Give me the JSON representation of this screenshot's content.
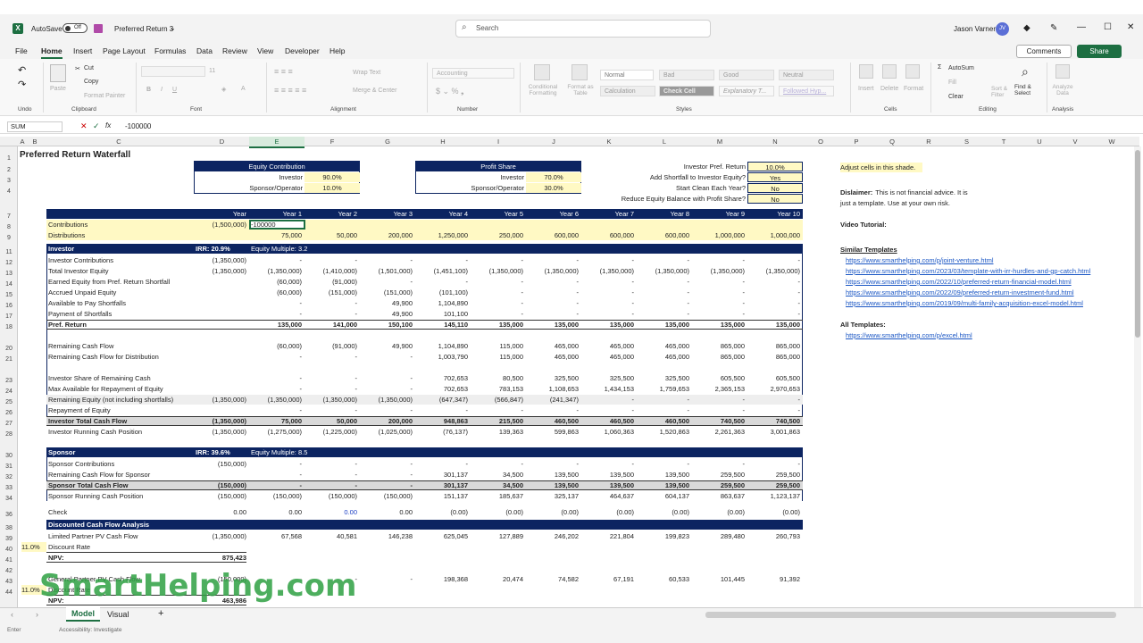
{
  "window": {
    "autosave": "AutoSave",
    "autosave_state": "Off",
    "filename": "Preferred Return 3",
    "search_placeholder": "Search",
    "user": "Jason Varner",
    "user_initials": "JV"
  },
  "menu": {
    "items": [
      "File",
      "Home",
      "Insert",
      "Page Layout",
      "Formulas",
      "Data",
      "Review",
      "View",
      "Developer",
      "Help"
    ],
    "comments": "Comments",
    "share": "Share"
  },
  "ribbon": {
    "undo": "Undo",
    "clipboard": "Clipboard",
    "paste": "Paste",
    "cut": "Cut",
    "copy": "Copy",
    "format_painter": "Format Painter",
    "font": "Font",
    "font_size": "11",
    "alignment": "Alignment",
    "wrap_text": "Wrap Text",
    "merge_center": "Merge & Center",
    "number": "Number",
    "number_format": "Accounting",
    "cond_fmt": "Conditional Formatting",
    "format_table": "Format as Table",
    "styles": "Styles",
    "style_normal": "Normal",
    "style_bad": "Bad",
    "style_good": "Good",
    "style_neutral": "Neutral",
    "style_calc": "Calculation",
    "style_check": "Check Cell",
    "style_expl": "Explanatory T...",
    "style_followed": "Followed Hyp...",
    "cells": "Cells",
    "insert": "Insert",
    "delete": "Delete",
    "format": "Format",
    "editing": "Editing",
    "autosum": "AutoSum",
    "fill": "Fill",
    "clear": "Clear",
    "sort_filter": "Sort & Filter",
    "find_select": "Find & Select",
    "analysis": "Analysis",
    "analyze_data": "Analyze Data"
  },
  "formula": {
    "namebox": "SUM",
    "fx": "fx",
    "value": "-100000"
  },
  "columns": [
    "A",
    "B",
    "C",
    "D",
    "E",
    "F",
    "G",
    "H",
    "I",
    "J",
    "K",
    "L",
    "M",
    "N",
    "O",
    "P",
    "Q",
    "R",
    "S",
    "T",
    "U",
    "V",
    "W"
  ],
  "rows": [
    "1",
    "2",
    "3",
    "4",
    "7",
    "8",
    "9",
    "11",
    "12",
    "13",
    "14",
    "15",
    "16",
    "17",
    "18",
    "20",
    "21",
    "23",
    "24",
    "25",
    "26",
    "27",
    "28",
    "30",
    "31",
    "32",
    "33",
    "34",
    "36",
    "38",
    "39",
    "40",
    "41",
    "42",
    "43",
    "44"
  ],
  "sheet": {
    "title": "Preferred Return Waterfall",
    "equity": {
      "header": "Equity Contribution",
      "investor_label": "Investor",
      "investor_val": "90.0%",
      "sponsor_label": "Sponsor/Operator",
      "sponsor_val": "10.0%"
    },
    "profit": {
      "header": "Profit Share",
      "investor_label": "Investor",
      "investor_val": "70.0%",
      "sponsor_label": "Sponsor/Operator",
      "sponsor_val": "30.0%"
    },
    "inputs": [
      {
        "label": "Investor Pref. Return",
        "val": "10.0%"
      },
      {
        "label": "Add Shortfall to Investor Equity?",
        "val": "Yes"
      },
      {
        "label": "Start Clean Each Year?",
        "val": "No"
      },
      {
        "label": "Reduce Equity Balance with Profit Share?",
        "val": "No"
      }
    ],
    "year_header": [
      "Year",
      "Year 1",
      "Year 2",
      "Year 3",
      "Year 4",
      "Year 5",
      "Year 6",
      "Year 7",
      "Year 8",
      "Year 9",
      "Year 10"
    ],
    "contrib_label": "Contributions",
    "contrib": [
      "(1,500,000)",
      "-100000",
      "",
      "",
      "",
      "",
      "",
      "",
      "",
      "",
      ""
    ],
    "dist_label": "Distributions",
    "dist": [
      "",
      "75,000",
      "50,000",
      "200,000",
      "1,250,000",
      "250,000",
      "600,000",
      "600,000",
      "600,000",
      "1,000,000",
      "1,000,000"
    ],
    "investor_hdr": "Investor",
    "investor_irr": "IRR: 20.9%",
    "investor_mult": "Equity Multiple: 3.2",
    "inv_rows": [
      {
        "label": "Investor Contributions",
        "v": [
          "(1,350,000)",
          "-",
          "-",
          "-",
          "-",
          "-",
          "-",
          "-",
          "-",
          "-",
          "-"
        ]
      },
      {
        "label": "Total Investor Equity",
        "v": [
          "(1,350,000)",
          "(1,350,000)",
          "(1,410,000)",
          "(1,501,000)",
          "(1,451,100)",
          "(1,350,000)",
          "(1,350,000)",
          "(1,350,000)",
          "(1,350,000)",
          "(1,350,000)",
          "(1,350,000)"
        ]
      },
      {
        "label": "Earned Equity from Pref. Return Shortfall",
        "v": [
          "",
          "(60,000)",
          "(91,000)",
          "-",
          "-",
          "-",
          "-",
          "-",
          "-",
          "-",
          "-"
        ]
      },
      {
        "label": "Accrued Unpaid Equity",
        "v": [
          "",
          "(60,000)",
          "(151,000)",
          "(151,000)",
          "(101,100)",
          "-",
          "-",
          "-",
          "-",
          "-",
          "-"
        ]
      },
      {
        "label": "Available to Pay Shortfalls",
        "v": [
          "",
          "-",
          "-",
          "49,900",
          "1,104,890",
          "-",
          "-",
          "-",
          "-",
          "-",
          "-"
        ]
      },
      {
        "label": "Payment of Shortfalls",
        "v": [
          "",
          "-",
          "-",
          "49,900",
          "101,100",
          "-",
          "-",
          "-",
          "-",
          "-",
          "-"
        ]
      },
      {
        "label": "Pref. Return",
        "v": [
          "",
          "135,000",
          "141,000",
          "150,100",
          "145,110",
          "135,000",
          "135,000",
          "135,000",
          "135,000",
          "135,000",
          "135,000"
        ],
        "bold": true
      },
      {
        "label": "Remaining Cash Flow",
        "v": [
          "",
          "(60,000)",
          "(91,000)",
          "49,900",
          "1,104,890",
          "115,000",
          "465,000",
          "465,000",
          "465,000",
          "865,000",
          "865,000"
        ]
      },
      {
        "label": "Remaining Cash Flow for Distribution",
        "v": [
          "",
          "-",
          "-",
          "-",
          "1,003,790",
          "115,000",
          "465,000",
          "465,000",
          "465,000",
          "865,000",
          "865,000"
        ]
      },
      {
        "label": "Investor Share of Remaining Cash",
        "v": [
          "",
          "-",
          "-",
          "-",
          "702,653",
          "80,500",
          "325,500",
          "325,500",
          "325,500",
          "605,500",
          "605,500"
        ]
      },
      {
        "label": "Max Available for Repayment of Equity",
        "v": [
          "",
          "-",
          "-",
          "-",
          "702,653",
          "783,153",
          "1,108,653",
          "1,434,153",
          "1,759,653",
          "2,365,153",
          "2,970,653"
        ]
      },
      {
        "label": "Remaining Equity (not including shortfalls)",
        "v": [
          "(1,350,000)",
          "(1,350,000)",
          "(1,350,000)",
          "(1,350,000)",
          "(647,347)",
          "(566,847)",
          "(241,347)",
          "-",
          "-",
          "-",
          "-"
        ]
      },
      {
        "label": "Repayment of Equity",
        "v": [
          "",
          "-",
          "-",
          "-",
          "-",
          "-",
          "-",
          "-",
          "-",
          "-",
          "-"
        ]
      },
      {
        "label": "Investor Total Cash Flow",
        "v": [
          "(1,350,000)",
          "75,000",
          "50,000",
          "200,000",
          "948,863",
          "215,500",
          "460,500",
          "460,500",
          "460,500",
          "740,500",
          "740,500"
        ],
        "bold": true
      },
      {
        "label": "Investor Running Cash Position",
        "v": [
          "(1,350,000)",
          "(1,275,000)",
          "(1,225,000)",
          "(1,025,000)",
          "(76,137)",
          "139,363",
          "599,863",
          "1,060,363",
          "1,520,863",
          "2,261,363",
          "3,001,863"
        ]
      }
    ],
    "sponsor_hdr": "Sponsor",
    "sponsor_irr": "IRR: 39.6%",
    "sponsor_mult": "Equity Multiple: 8.5",
    "sp_rows": [
      {
        "label": "Sponsor Contributions",
        "v": [
          "(150,000)",
          "-",
          "-",
          "-",
          "-",
          "-",
          "-",
          "-",
          "-",
          "-",
          "-"
        ]
      },
      {
        "label": "Remaining Cash Flow for Sponsor",
        "v": [
          "",
          "-",
          "-",
          "-",
          "301,137",
          "34,500",
          "139,500",
          "139,500",
          "139,500",
          "259,500",
          "259,500"
        ]
      },
      {
        "label": "Sponsor Total Cash Flow",
        "v": [
          "(150,000)",
          "-",
          "-",
          "-",
          "301,137",
          "34,500",
          "139,500",
          "139,500",
          "139,500",
          "259,500",
          "259,500"
        ],
        "bold": true
      },
      {
        "label": "Sponsor Running Cash Position",
        "v": [
          "(150,000)",
          "(150,000)",
          "(150,000)",
          "(150,000)",
          "151,137",
          "185,637",
          "325,137",
          "464,637",
          "604,137",
          "863,637",
          "1,123,137"
        ]
      },
      {
        "label": "Check",
        "v": [
          "0.00",
          "0.00",
          "0.00",
          "0.00",
          "(0.00)",
          "(0.00)",
          "(0.00)",
          "(0.00)",
          "(0.00)",
          "(0.00)",
          "(0.00)"
        ]
      }
    ],
    "dcf_hdr": "Discounted Cash Flow Analysis",
    "lp_label": "Limited Partner PV Cash Flow",
    "lp": [
      "(1,350,000)",
      "67,568",
      "40,581",
      "146,238",
      "625,045",
      "127,889",
      "246,202",
      "221,804",
      "199,823",
      "289,480",
      "260,793"
    ],
    "disc_rate_val": "11.0%",
    "disc_rate_label": "Discount Rate",
    "npv_label": "NPV:",
    "npv_lp": "875,423",
    "gp_label": "General Partner PV Cash Flow",
    "gp": [
      "(150,000)",
      "-",
      "-",
      "-",
      "198,368",
      "20,474",
      "74,582",
      "67,191",
      "60,533",
      "101,445",
      "91,392"
    ],
    "disc_rate_val2": "11.0%",
    "disc_rate_label2": "Discount Rate",
    "npv_label2": "NPV:",
    "npv_gp": "463,986",
    "note_adjust": "Adjust cells in this shade.",
    "disclaimer_bold": "Dislaimer:",
    "disclaimer_1": "This is not financial advice. It is",
    "disclaimer_2": "just a template. Use at your own risk.",
    "video": "Video Tutorial:",
    "similar": "Similar Templates",
    "links": [
      "https://www.smarthelping.com/p/joint-venture.html",
      "https://www.smarthelping.com/2023/03/template-with-irr-hurdles-and-gp-catch.html",
      "https://www.smarthelping.com/2022/10/preferred-return-financial-model.html",
      "https://www.smarthelping.com/2022/09/preferred-return-investment-fund.html",
      "https://www.smarthelping.com/2019/09/multi-family-acquisition-excel-model.html"
    ],
    "all_templates": "All Templates:",
    "all_link": "https://www.smarthelping.com/p/excel.html"
  },
  "tabs": [
    "Model",
    "Visual"
  ],
  "watermark": "SmartHelping.com",
  "status": {
    "mode": "Enter",
    "accessibility": "Accessibility: Investigate"
  }
}
